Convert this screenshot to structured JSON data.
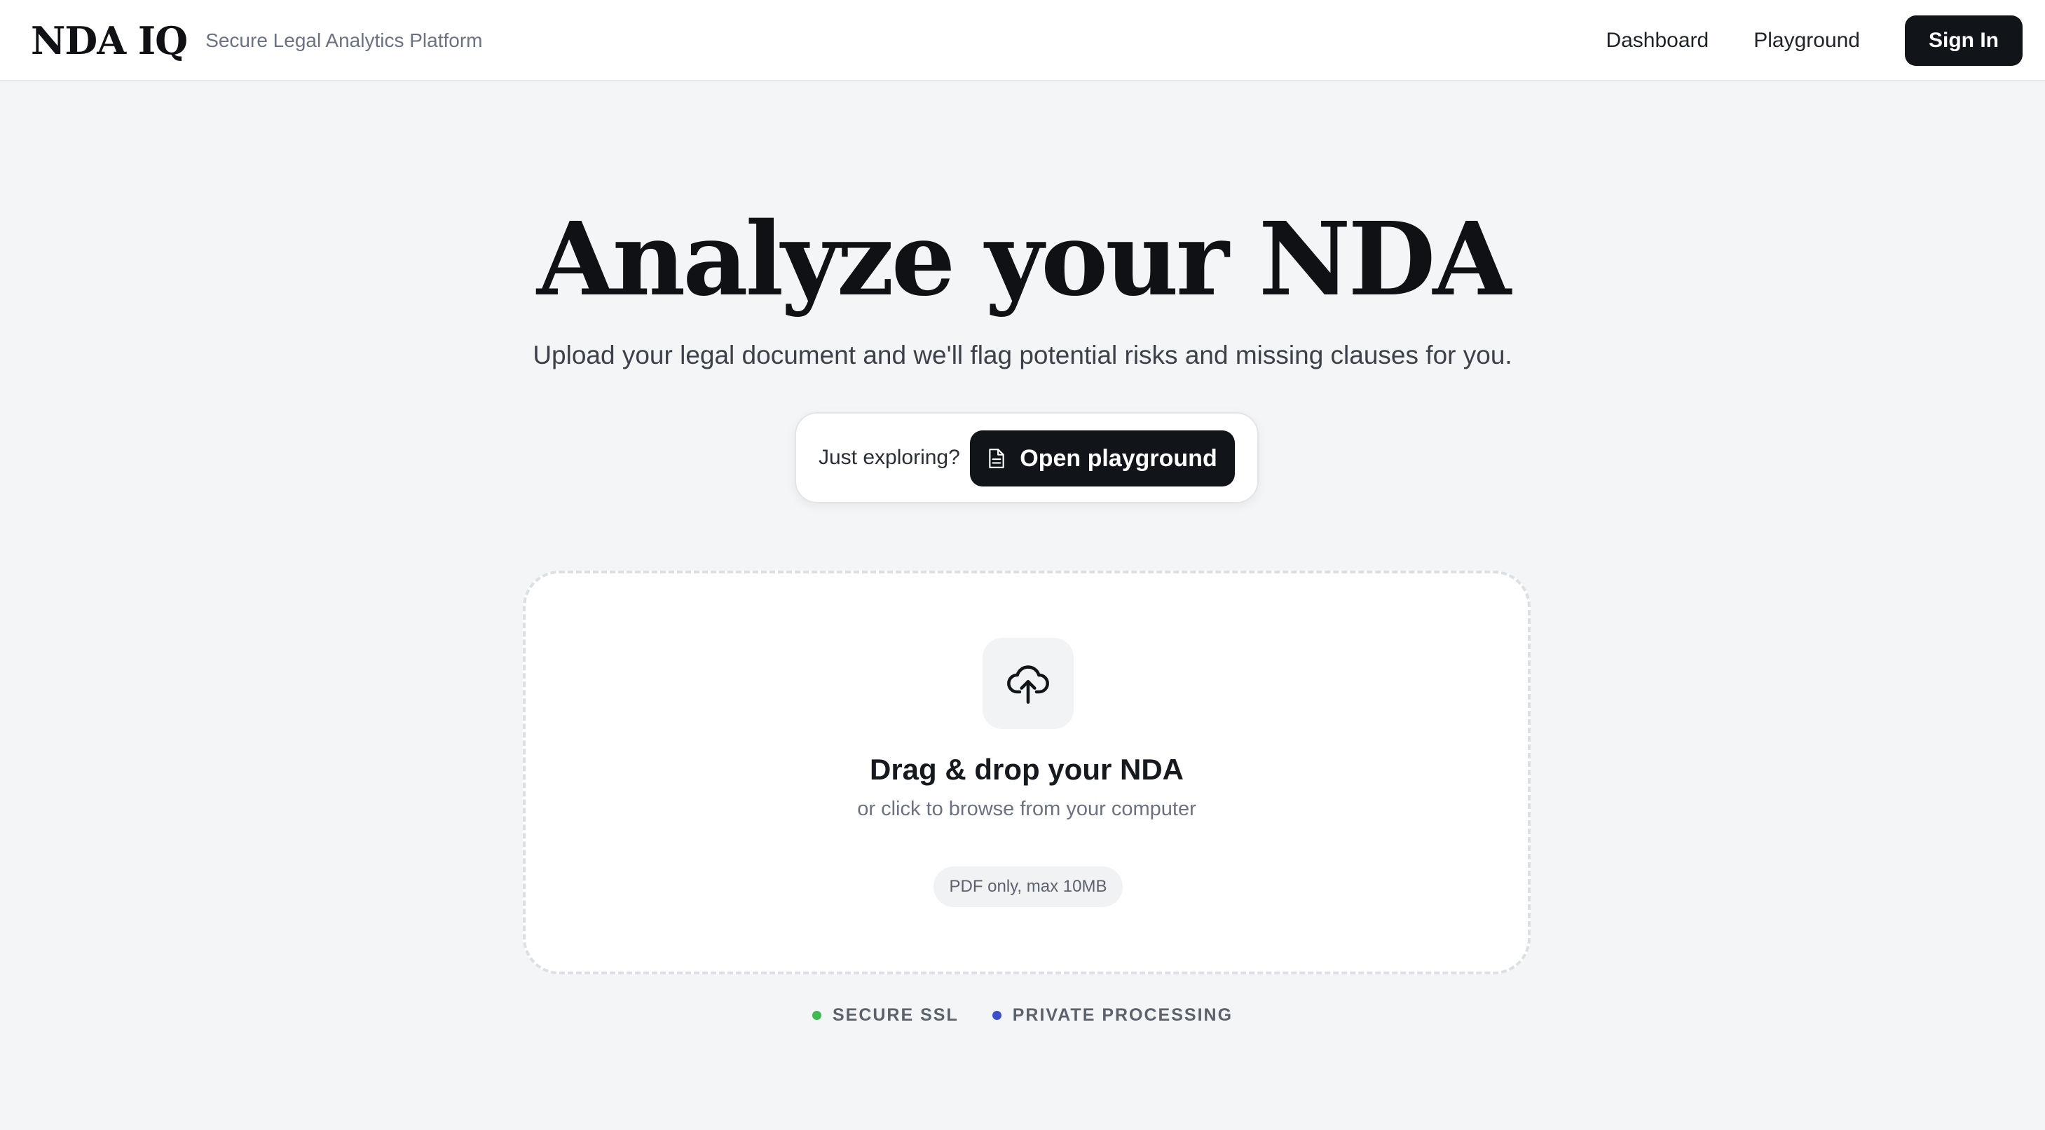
{
  "header": {
    "logo": "NDA IQ",
    "tagline": "Secure Legal Analytics Platform",
    "nav": {
      "dashboard": "Dashboard",
      "playground": "Playground"
    },
    "signin_label": "Sign In"
  },
  "hero": {
    "title": "Analyze your NDA",
    "subtitle": "Upload your legal document and we'll flag potential risks and missing clauses for you."
  },
  "explore": {
    "prompt": "Just exploring?",
    "button_label": "Open playground",
    "button_icon": "document-icon"
  },
  "dropzone": {
    "icon": "cloud-upload-icon",
    "title": "Drag & drop your NDA",
    "subtitle": "or click to browse from your computer",
    "format_note": "PDF only, max 10MB"
  },
  "trust": [
    {
      "label": "SECURE SSL",
      "color": "#3fb950"
    },
    {
      "label": "PRIVATE PROCESSING",
      "color": "#3b4fc8"
    }
  ],
  "colors": {
    "primary": "#111418",
    "background": "#f4f5f7",
    "surface": "#ffffff"
  }
}
